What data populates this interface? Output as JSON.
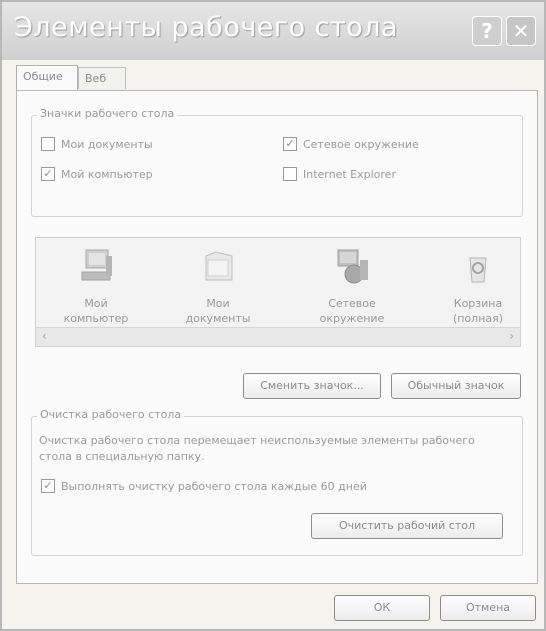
{
  "window": {
    "title": "Элементы рабочего стола",
    "help_label": "?",
    "close_label": "✕"
  },
  "tabs": [
    {
      "label": "Общие"
    },
    {
      "label": "Веб"
    }
  ],
  "icons_group": {
    "title": "Значки рабочего стола",
    "checkboxes": [
      {
        "label": "Мои документы",
        "checked": false
      },
      {
        "label": "Сетевое окружение",
        "checked": true
      },
      {
        "label": "Мой компьютер",
        "checked": true
      },
      {
        "label": "Internet Explorer",
        "checked": false
      }
    ]
  },
  "icon_list": [
    {
      "caption": "Мой компьютер",
      "icon": "my-computer-icon"
    },
    {
      "caption": "Мои документы",
      "icon": "my-documents-icon"
    },
    {
      "caption": "Сетевое окружение",
      "icon": "network-places-icon"
    },
    {
      "caption": "Корзина (полная)",
      "icon": "recycle-bin-full-icon"
    }
  ],
  "scroll": {
    "left": "‹",
    "right": "›"
  },
  "icon_buttons": {
    "change": "Сменить значок...",
    "default": "Обычный значок"
  },
  "cleanup_group": {
    "title": "Очистка рабочего стола",
    "description": "Очистка рабочего стола перемещает неиспользуемые элементы рабочего стола в специальную папку.",
    "checkbox": {
      "label": "Выполнять очистку рабочего стола каждые 60 дней",
      "checked": true
    },
    "button": "Очистить рабочий стол"
  },
  "footer": {
    "ok": "ОК",
    "cancel": "Отмена"
  },
  "colors": {
    "titlebar": "#d6d6d6",
    "panel": "#fbfbfb",
    "window": "#f4f3ee",
    "text": "#9a9a9a"
  }
}
